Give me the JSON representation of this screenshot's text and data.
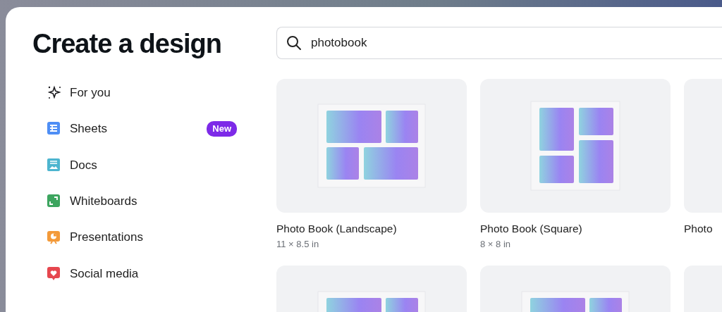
{
  "title": "Create a design",
  "sidebar": {
    "items": [
      {
        "label": "For you",
        "kind": "sparkle",
        "color": "#1b1b1f"
      },
      {
        "label": "Sheets",
        "kind": "sheets",
        "color": "#4e8ef5",
        "badge": "New"
      },
      {
        "label": "Docs",
        "kind": "docs",
        "color": "#4db5cf"
      },
      {
        "label": "Whiteboards",
        "kind": "whiteboards",
        "color": "#3da55f"
      },
      {
        "label": "Presentations",
        "kind": "presentations",
        "color": "#f39a3a"
      },
      {
        "label": "Social media",
        "kind": "social",
        "color": "#e6464e"
      }
    ]
  },
  "search": {
    "value": "photobook"
  },
  "results": [
    {
      "kind": "landscape",
      "title": "Photo Book (Landscape)",
      "size": "11 × 8.5 in"
    },
    {
      "kind": "square",
      "title": "Photo Book (Square)",
      "size": "8 × 8 in"
    },
    {
      "kind": "blank",
      "title": "Photo"
    },
    {
      "kind": "landscape"
    },
    {
      "kind": "wide"
    },
    {
      "kind": "blank"
    }
  ]
}
